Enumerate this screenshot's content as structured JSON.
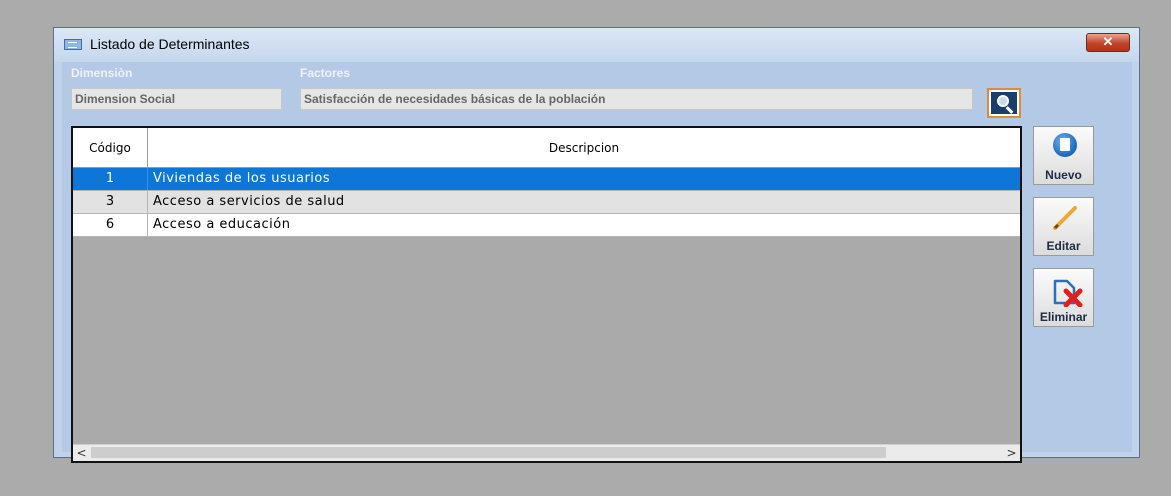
{
  "window": {
    "title": "Listado de Determinantes",
    "close_label": "✕"
  },
  "filters": {
    "dimension_label": "Dimensiòn",
    "dimension_value": "Dimension Social",
    "factores_label": "Factores",
    "factores_value": "Satisfacción de necesidades básicas de la  población"
  },
  "grid": {
    "columns": [
      "Código",
      "Descripcion"
    ],
    "rows": [
      {
        "codigo": "1",
        "descripcion": "Viviendas  de  los usuarios",
        "selected": true
      },
      {
        "codigo": "3",
        "descripcion": "Acceso a servicios de  salud",
        "selected": false
      },
      {
        "codigo": "6",
        "descripcion": "Acceso a educación",
        "selected": false
      }
    ],
    "scroll_left": "<",
    "scroll_right": ">"
  },
  "actions": {
    "nuevo": "Nuevo",
    "editar": "Editar",
    "eliminar": "Eliminar"
  },
  "colors": {
    "selection": "#0c77d8",
    "window_bg": "#b4c9e5",
    "search_border": "#e1893b"
  },
  "icons": [
    "window-icon",
    "close-icon",
    "search-icon",
    "new-document-icon",
    "pencil-icon",
    "delete-document-icon"
  ]
}
